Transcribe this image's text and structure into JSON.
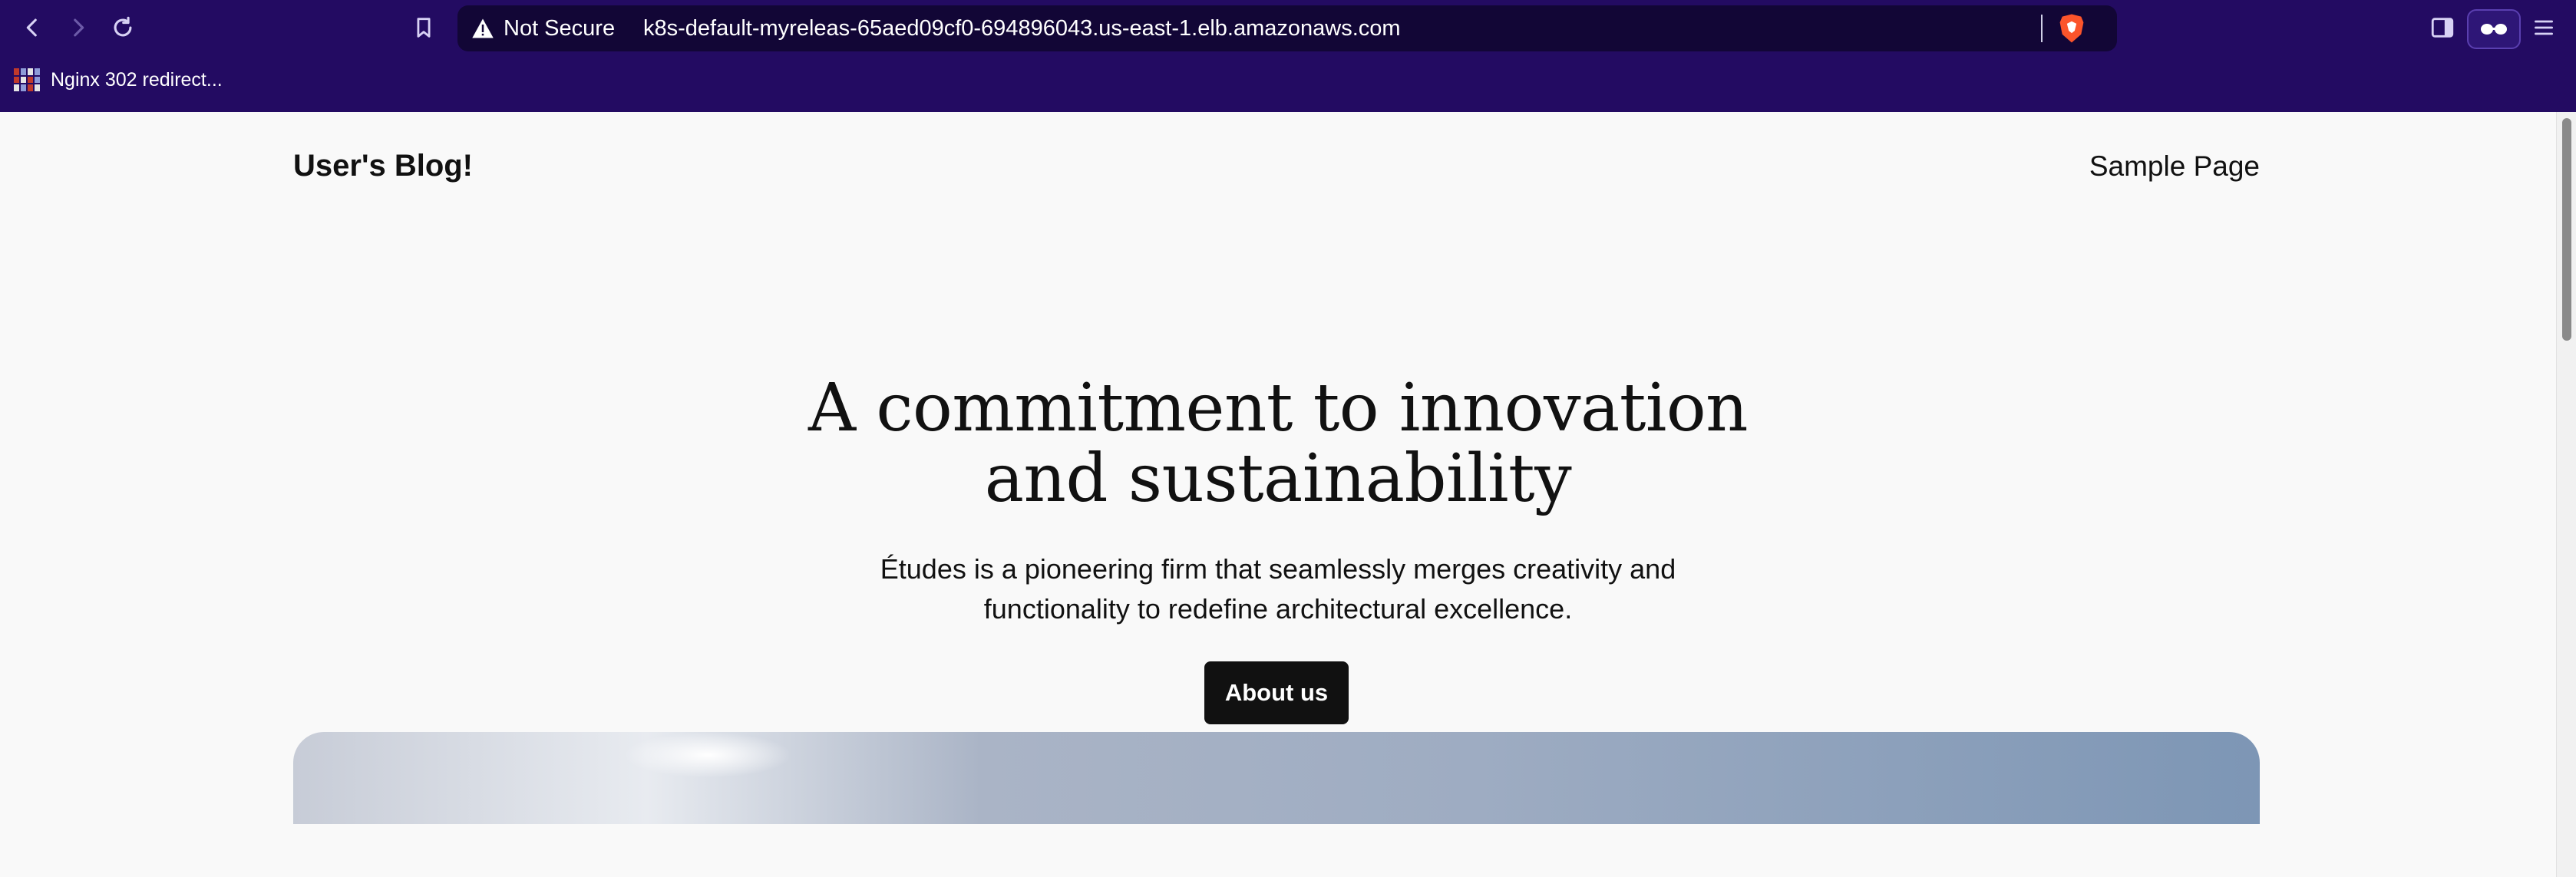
{
  "browser": {
    "security_label": "Not Secure",
    "url": "k8s-default-myreleas-65aed09cf0-694896043.us-east-1.elb.amazonaws.com",
    "bookmark_label": "Nginx 302 redirect...",
    "icons": [
      "back-icon",
      "forward-icon",
      "reload-icon",
      "bookmark-icon",
      "warning-icon",
      "brave-shield-icon",
      "sidebar-icon",
      "glasses-icon",
      "menu-icon"
    ],
    "chrome_color": "#230b62"
  },
  "site": {
    "title": "User's Blog!",
    "nav_link": "Sample Page"
  },
  "hero": {
    "title_line1": "A commitment to innovation",
    "title_line2": "and sustainability",
    "subtitle_line1": "Études is a pioneering firm that seamlessly merges creativity and",
    "subtitle_line2": "functionality to redefine architectural excellence.",
    "button_label": "About us"
  }
}
